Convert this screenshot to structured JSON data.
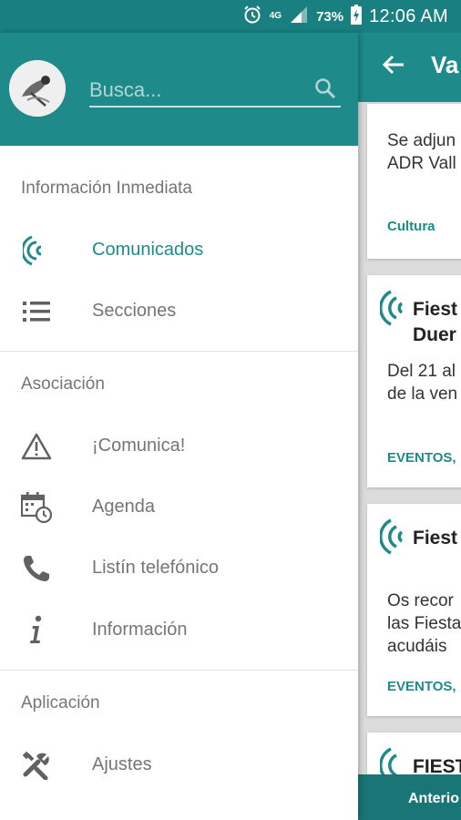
{
  "status_bar": {
    "network": "4G",
    "battery": "73%",
    "time": "12:06 AM",
    "icons": [
      "alarm-icon",
      "signal-icon",
      "battery-charging-icon"
    ]
  },
  "background": {
    "toolbar_title": "Va",
    "cards": [
      {
        "text_lines": [
          "Se adjun",
          "ADR Vall"
        ],
        "tag": "Cultura"
      },
      {
        "title_lines": [
          "Fiest",
          "Duer"
        ],
        "text_lines": [
          "Del 21 al",
          "de la ven"
        ],
        "tag": "EVENTOS,"
      },
      {
        "title_lines": [
          "Fiest"
        ],
        "text_lines": [
          "Os recor",
          "las Fiesta",
          "acudáis"
        ],
        "tag": "EVENTOS,"
      },
      {
        "title_lines": [
          "FIEST"
        ]
      }
    ],
    "bottom_button": "Anterio"
  },
  "drawer": {
    "search": {
      "placeholder": "Busca..."
    },
    "sections": [
      {
        "title": "Información Inmediata",
        "items": [
          {
            "label": "Comunicados",
            "icon": "broadcast-icon",
            "active": true
          },
          {
            "label": "Secciones",
            "icon": "list-icon"
          }
        ]
      },
      {
        "title": "Asociación",
        "items": [
          {
            "label": "¡Comunica!",
            "icon": "warning-icon"
          },
          {
            "label": "Agenda",
            "icon": "calendar-clock-icon"
          },
          {
            "label": "Listín telefónico",
            "icon": "phone-icon"
          },
          {
            "label": "Información",
            "icon": "info-icon"
          }
        ]
      },
      {
        "title": "Aplicación",
        "items": [
          {
            "label": "Ajustes",
            "icon": "tools-icon"
          }
        ]
      }
    ]
  },
  "colors": {
    "primary": "#1f8a8a",
    "primary_dark": "#1a7f80",
    "text_secondary": "#757575"
  }
}
